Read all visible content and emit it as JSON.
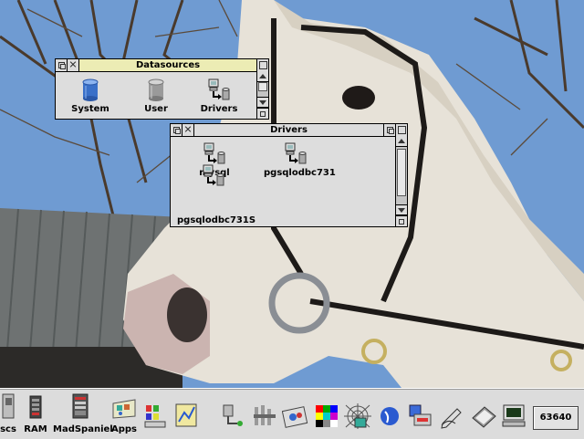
{
  "datasources_window": {
    "title": "Datasources",
    "icons": [
      {
        "label": "System",
        "icon": "database-blue-icon"
      },
      {
        "label": "User",
        "icon": "database-grey-icon"
      },
      {
        "label": "Drivers",
        "icon": "driver-computer-icon"
      }
    ]
  },
  "drivers_window": {
    "title": "Drivers",
    "icons": [
      {
        "label": "mysql",
        "icon": "driver-computer-icon"
      },
      {
        "label": "pgsqlodbc731",
        "icon": "driver-computer-icon"
      },
      {
        "label": "pgsqlodbc731S",
        "icon": "driver-computer-icon"
      }
    ]
  },
  "iconbar": {
    "left_items": [
      {
        "label": "scs",
        "icon": "floppy-disc-icon"
      },
      {
        "label": "RAM",
        "icon": "ram-disc-icon"
      },
      {
        "label": "MadSpaniel",
        "icon": "harddisc-icon"
      },
      {
        "label": "Apps",
        "icon": "apps-folder-icon"
      }
    ],
    "clock": "63640"
  }
}
